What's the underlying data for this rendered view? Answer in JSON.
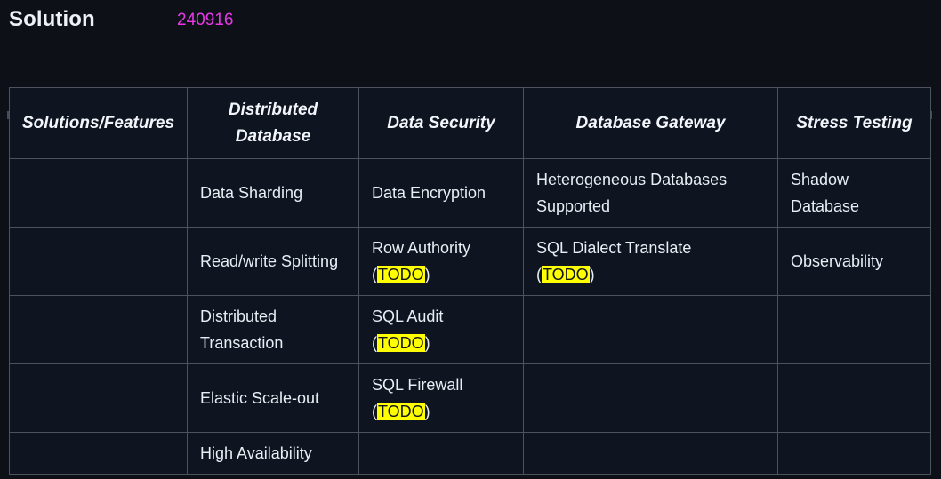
{
  "header": {
    "title": "Solution",
    "tag": "240916",
    "tag_color": "#e838e8"
  },
  "scrollbar": {
    "name": "horizontal-scrollbar",
    "thumb_color": "#454d5c",
    "orientation": "horizontal"
  },
  "table": {
    "columns": [
      "Solutions/Features",
      "Distributed Database",
      "Data Security",
      "Database Gateway",
      "Stress Testing"
    ],
    "highlight_label": "TODO",
    "highlight_color": "#ffff00",
    "rows": [
      {
        "c0": "",
        "c1": {
          "text": "Data Sharding",
          "todo": false
        },
        "c2": {
          "text": "Data Encryption",
          "todo": false
        },
        "c3": {
          "text": "Heterogeneous Databases Supported",
          "todo": false
        },
        "c4": {
          "text": "Shadow Database",
          "todo": false
        }
      },
      {
        "c0": "",
        "c1": {
          "text": "Read/write Splitting",
          "todo": false
        },
        "c2": {
          "text": "Row Authority",
          "todo": true
        },
        "c3": {
          "text": "SQL Dialect Translate",
          "todo": true
        },
        "c4": {
          "text": "Observability",
          "todo": false
        }
      },
      {
        "c0": "",
        "c1": {
          "text": "Distributed Transaction",
          "todo": false
        },
        "c2": {
          "text": "SQL Audit",
          "todo": true
        },
        "c3": {
          "text": "",
          "todo": false
        },
        "c4": {
          "text": "",
          "todo": false
        }
      },
      {
        "c0": "",
        "c1": {
          "text": "Elastic Scale-out",
          "todo": false
        },
        "c2": {
          "text": "SQL Firewall",
          "todo": true
        },
        "c3": {
          "text": "",
          "todo": false
        },
        "c4": {
          "text": "",
          "todo": false
        }
      },
      {
        "c0": "",
        "c1": {
          "text": "High Availability",
          "todo": false
        },
        "c2": {
          "text": "",
          "todo": false
        },
        "c3": {
          "text": "",
          "todo": false
        },
        "c4": {
          "text": "",
          "todo": false
        }
      }
    ]
  }
}
